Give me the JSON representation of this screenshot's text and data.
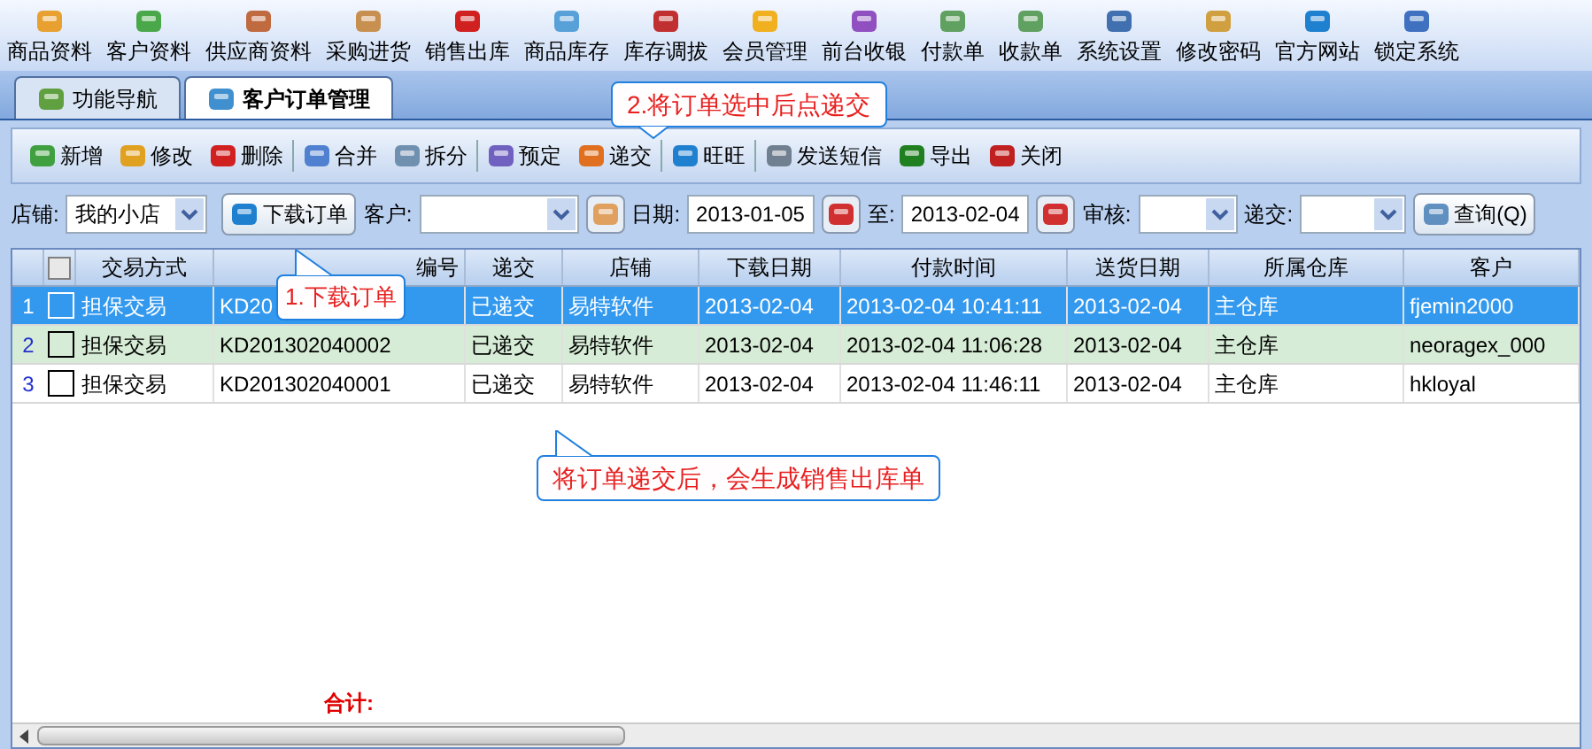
{
  "menu": [
    "商品资料",
    "客户资料",
    "供应商资料",
    "采购进货",
    "销售出库",
    "商品库存",
    "库存调拔",
    "会员管理",
    "前台收银",
    "付款单",
    "收款单",
    "系统设置",
    "修改密码",
    "官方网站",
    "锁定系统"
  ],
  "tabs": [
    {
      "label": "功能导航",
      "selected": false
    },
    {
      "label": "客户订单管理",
      "selected": true
    }
  ],
  "toolbar": [
    [
      "新增",
      "修改",
      "删除"
    ],
    [
      "合并",
      "拆分"
    ],
    [
      "预定",
      "递交"
    ],
    [
      "旺旺"
    ],
    [
      "发送短信",
      "导出",
      "关闭"
    ]
  ],
  "filters": {
    "shop_label": "店铺:",
    "shop_value": "我的小店",
    "download_button": "下载订单",
    "customer_label": "客户:",
    "date_label": "日期:",
    "date_from": "2013-01-05",
    "to_label": "至:",
    "date_to": "2013-02-04",
    "review_label": "审核:",
    "submit_label": "递交:",
    "query_button": "查询(Q)"
  },
  "table": {
    "columns": [
      "交易方式",
      "编号",
      "递交",
      "店铺",
      "下载日期",
      "付款时间",
      "送货日期",
      "所属仓库",
      "客户"
    ],
    "select_all_checked": false,
    "rows": [
      {
        "index": "1",
        "selected": true,
        "hover": false,
        "checked": false,
        "cells": [
          "担保交易",
          "KD20",
          "已递交",
          "易特软件",
          "2013-02-04",
          "2013-02-04 10:41:11",
          "2013-02-04",
          "主仓库",
          "fjemin2000"
        ]
      },
      {
        "index": "2",
        "selected": false,
        "hover": true,
        "checked": false,
        "cells": [
          "担保交易",
          "KD201302040002",
          "已递交",
          "易特软件",
          "2013-02-04",
          "2013-02-04 11:06:28",
          "2013-02-04",
          "主仓库",
          "neoragex_000"
        ]
      },
      {
        "index": "3",
        "selected": false,
        "hover": false,
        "checked": false,
        "cells": [
          "担保交易",
          "KD201302040001",
          "已递交",
          "易特软件",
          "2013-02-04",
          "2013-02-04 11:46:11",
          "2013-02-04",
          "主仓库",
          "hkloyal"
        ]
      }
    ],
    "total_label": "合计:"
  },
  "callouts": [
    "1.下载订单",
    "2.将订单选中后点递交",
    "将订单递交后，会生成销售出库单"
  ]
}
